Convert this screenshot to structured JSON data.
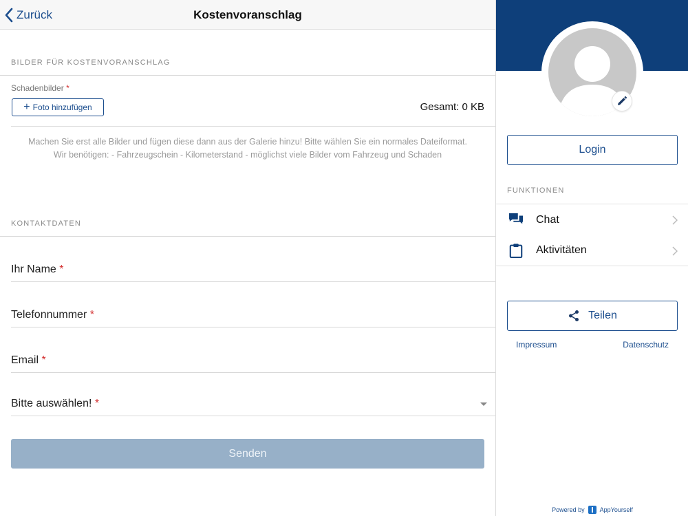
{
  "nav": {
    "back_label": "Zurück",
    "title": "Kostenvoranschlag"
  },
  "images_section": {
    "header": "BILDER FÜR KOSTENVORANSCHLAG",
    "field_label": "Schadenbilder",
    "required_mark": "*",
    "add_photo_label": "Foto hinzufügen",
    "total_label": "Gesamt: 0 KB",
    "hint": "Machen Sie erst alle Bilder und fügen diese dann aus der Galerie hinzu! Bitte wählen Sie ein normales Dateiformat. Wir benötigen: - Fahrzeugschein - Kilometerstand - möglichst viele Bilder vom Fahrzeug und Schaden"
  },
  "contact_section": {
    "header": "KONTAKTDATEN",
    "fields": [
      {
        "label": "Ihr Name",
        "required_mark": "*"
      },
      {
        "label": "Telefonnummer",
        "required_mark": "*"
      },
      {
        "label": "Email",
        "required_mark": "*"
      },
      {
        "label": "Bitte auswählen!",
        "required_mark": "*",
        "type": "select"
      }
    ],
    "submit_label": "Senden"
  },
  "sidebar": {
    "login_label": "Login",
    "functions_header": "FUNKTIONEN",
    "menu": [
      {
        "label": "Chat",
        "icon": "chat-icon"
      },
      {
        "label": "Aktivitäten",
        "icon": "clipboard-icon"
      }
    ],
    "share_label": "Teilen",
    "impressum_label": "Impressum",
    "datenschutz_label": "Datenschutz",
    "powered_by": "Powered by",
    "brand": "AppYourself"
  },
  "colors": {
    "primary": "#1c4e8e",
    "banner": "#0e3f7a",
    "submit_disabled": "#97b0c8",
    "required": "#d32f2f"
  }
}
